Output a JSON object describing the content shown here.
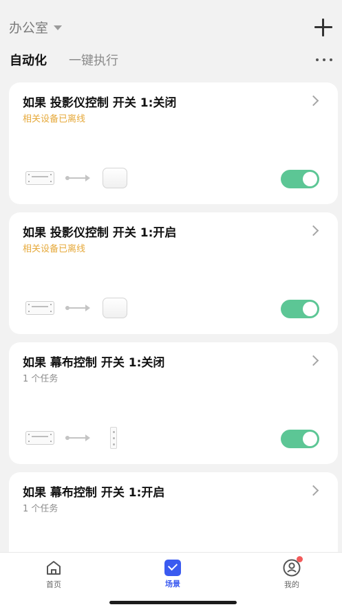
{
  "header": {
    "room_name": "办公室",
    "room_caret_icon": "caret-down-icon",
    "add_icon": "plus-icon"
  },
  "tabs": [
    {
      "label": "自动化",
      "active": true
    },
    {
      "label": "一键执行",
      "active": false
    }
  ],
  "more_icon": "more-horizontal-icon",
  "scenes": [
    {
      "title": "如果 投影仪控制 开关 1:关闭",
      "subtitle": "相关设备已离线",
      "subtitle_status": "warning",
      "target_device": "box-device",
      "enabled": true
    },
    {
      "title": "如果 投影仪控制 开关 1:开启",
      "subtitle": "相关设备已离线",
      "subtitle_status": "warning",
      "target_device": "box-device",
      "enabled": true
    },
    {
      "title": "如果 幕布控制 开关 1:关闭",
      "subtitle": "1 个任务",
      "subtitle_status": "normal",
      "target_device": "strip-device",
      "enabled": true
    },
    {
      "title": "如果 幕布控制 开关 1:开启",
      "subtitle": "1 个任务",
      "subtitle_status": "normal",
      "target_device": "strip-device",
      "enabled": true
    }
  ],
  "bottom_nav": [
    {
      "label": "首页",
      "icon": "home-icon",
      "active": false
    },
    {
      "label": "场景",
      "icon": "scene-check-icon",
      "active": true
    },
    {
      "label": "我的",
      "icon": "profile-icon",
      "active": false,
      "badge": true
    }
  ],
  "colors": {
    "accent": "#3a5af0",
    "toggle_on": "#5cc695",
    "warning_text": "#e6a93b",
    "background": "#f2f2f2"
  }
}
